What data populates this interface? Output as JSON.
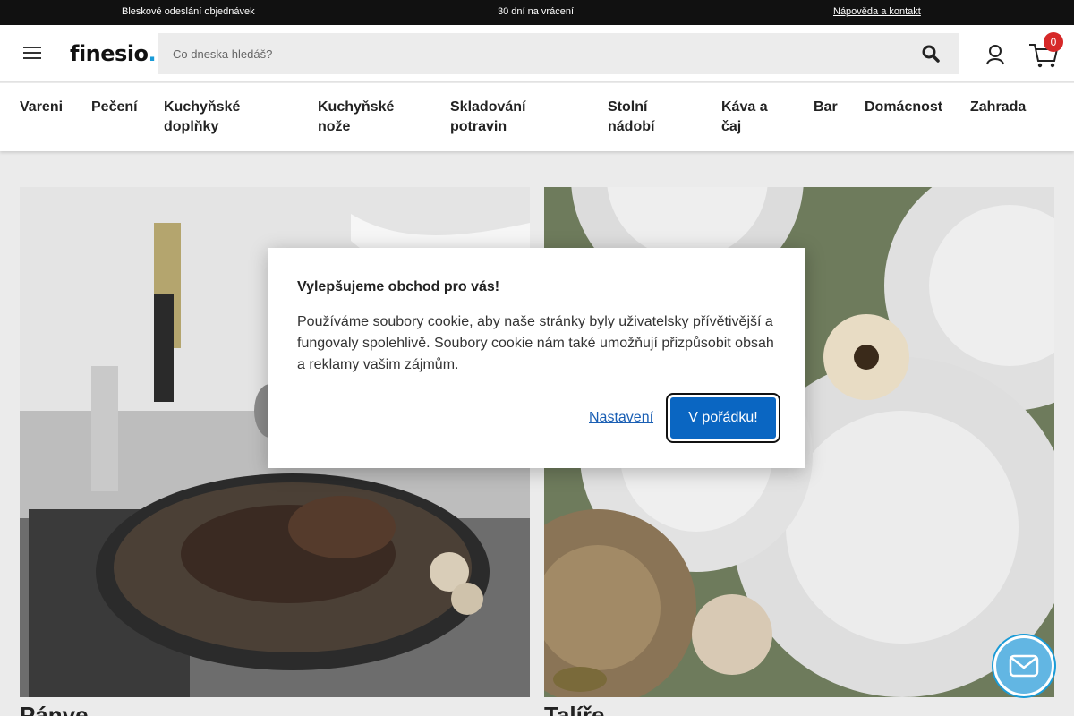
{
  "topbar": {
    "shipping": "Bleskové odeslání objednávek",
    "returns": "30 dní na vrácení",
    "help": "Nápověda a kontakt"
  },
  "header": {
    "logo_text": "finesio",
    "logo_dot": ".",
    "search_placeholder": "Co dneska hledáš?",
    "cart_count": "0"
  },
  "categories": [
    "Vareni",
    "Pečení",
    "Kuchyňské doplňky",
    "Kuchyňské nože",
    "Skladování potravin",
    "Stolní nádobí",
    "Káva a čaj",
    "Bar",
    "Domácnost",
    "Zahrada"
  ],
  "cards": [
    {
      "label": "Pánve"
    },
    {
      "label": "Talíře"
    }
  ],
  "cookie": {
    "title": "Vylepšujeme obchod pro vás!",
    "text": "Používáme soubory cookie, aby naše stránky byly uživatelsky přívětivější a fungovaly spolehlivě. Soubory cookie nám také umožňují přizpůsobit obsah a reklamy vašim zájmům.",
    "settings_label": "Nastavení",
    "accept_label": "V pořádku!"
  },
  "colors": {
    "topbar_bg": "#111111",
    "accent": "#1a9bd7",
    "primary_button": "#0a66c2",
    "badge": "#d62828"
  }
}
